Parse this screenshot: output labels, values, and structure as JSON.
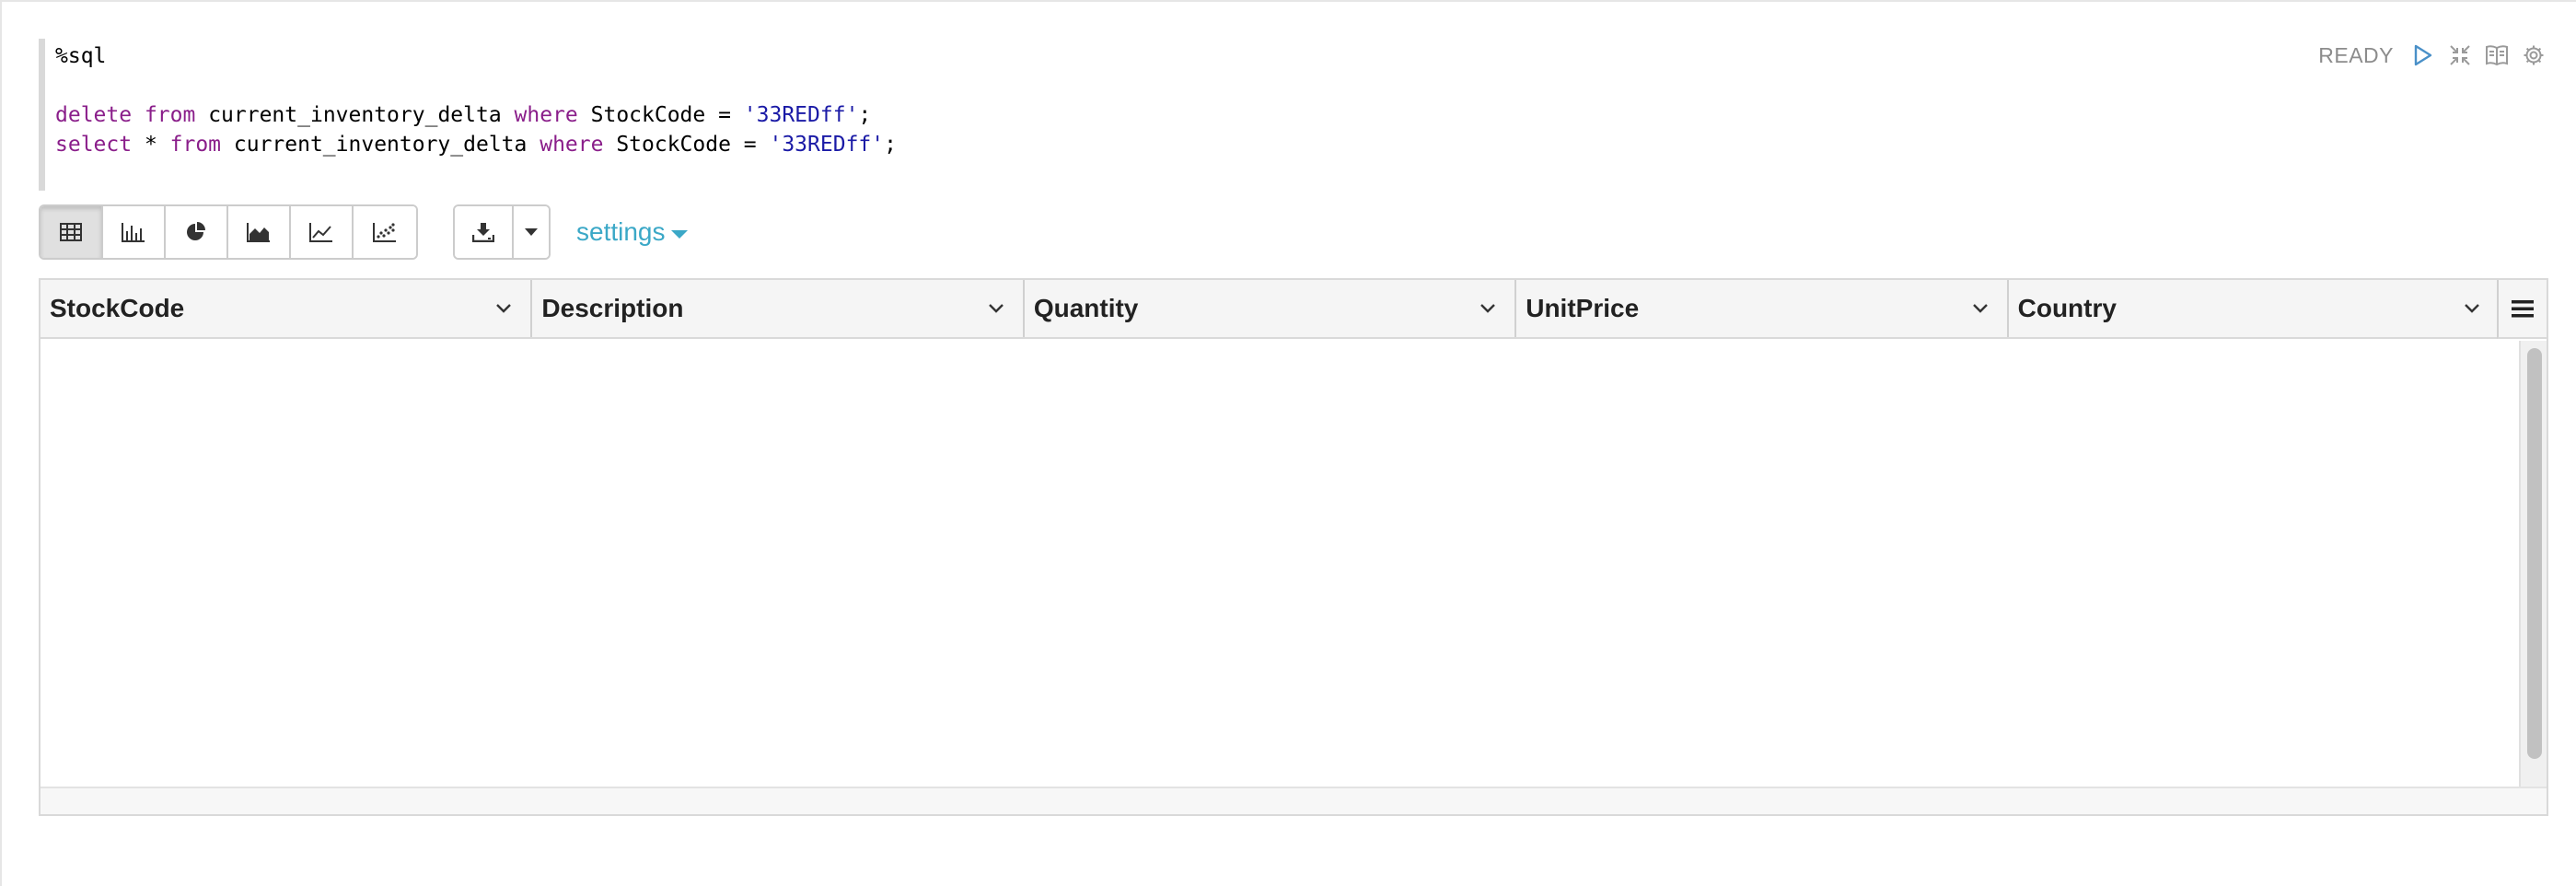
{
  "editor": {
    "lines": [
      [
        {
          "t": "%sql",
          "c": "ident"
        }
      ],
      [],
      [
        {
          "t": "delete",
          "c": "kw"
        },
        {
          "t": " ",
          "c": "ident"
        },
        {
          "t": "from",
          "c": "kw"
        },
        {
          "t": " current_inventory_delta ",
          "c": "ident"
        },
        {
          "t": "where",
          "c": "kw"
        },
        {
          "t": " StockCode = ",
          "c": "ident"
        },
        {
          "t": "'33REDff'",
          "c": "str"
        },
        {
          "t": ";",
          "c": "ident"
        }
      ],
      [
        {
          "t": "select",
          "c": "kw"
        },
        {
          "t": " * ",
          "c": "ident"
        },
        {
          "t": "from",
          "c": "kw"
        },
        {
          "t": " current_inventory_delta ",
          "c": "ident"
        },
        {
          "t": "where",
          "c": "kw"
        },
        {
          "t": " StockCode = ",
          "c": "ident"
        },
        {
          "t": "'33REDff'",
          "c": "str"
        },
        {
          "t": ";",
          "c": "ident"
        }
      ]
    ]
  },
  "controls": {
    "status": "READY",
    "icons": [
      "run-icon",
      "collapse-icon",
      "book-icon",
      "gear-icon"
    ]
  },
  "toolbar": {
    "visualizations": [
      {
        "name": "table-view-button",
        "icon": "table-icon",
        "active": true
      },
      {
        "name": "bar-chart-button",
        "icon": "bar-chart-icon",
        "active": false
      },
      {
        "name": "pie-chart-button",
        "icon": "pie-chart-icon",
        "active": false
      },
      {
        "name": "area-chart-button",
        "icon": "area-chart-icon",
        "active": false
      },
      {
        "name": "line-chart-button",
        "icon": "line-chart-icon",
        "active": false
      },
      {
        "name": "scatter-chart-button",
        "icon": "scatter-chart-icon",
        "active": false
      }
    ],
    "settings_label": "settings"
  },
  "table": {
    "columns": [
      "StockCode",
      "Description",
      "Quantity",
      "UnitPrice",
      "Country"
    ],
    "rows": []
  },
  "colors": {
    "keyword": "#8a1e8a",
    "string": "#1a1aa6",
    "settings_link": "#3ba8c7",
    "status": "#8c8c8c"
  }
}
